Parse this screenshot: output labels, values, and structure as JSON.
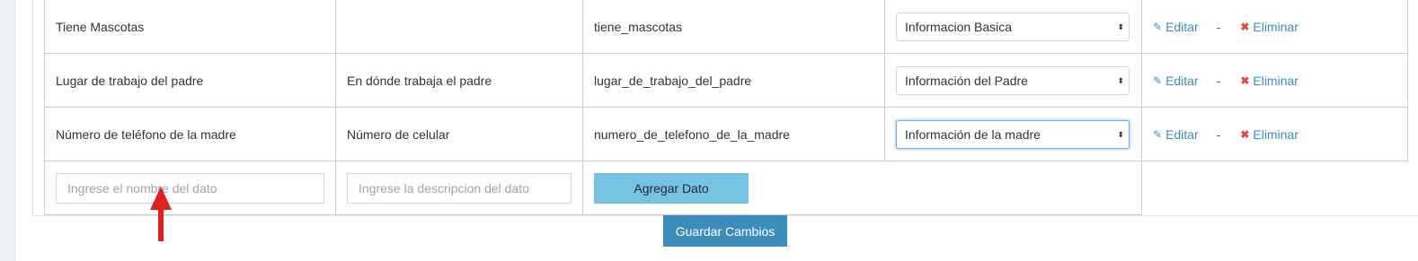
{
  "rows": [
    {
      "name": "Tiene Mascotas",
      "description": "",
      "key": "tiene_mascotas",
      "category": "Informacion Basica",
      "edit_label": "Editar",
      "separator": "-",
      "delete_label": "Eliminar"
    },
    {
      "name": "Lugar de trabajo del padre",
      "description": "En dónde trabaja el padre",
      "key": "lugar_de_trabajo_del_padre",
      "category": "Información del Padre",
      "edit_label": "Editar",
      "separator": "-",
      "delete_label": "Eliminar"
    },
    {
      "name": "Número de teléfono de la madre",
      "description": "Número de celular",
      "key": "numero_de_telefono_de_la_madre",
      "category": "Información de la madre",
      "edit_label": "Editar",
      "separator": "-",
      "delete_label": "Eliminar"
    }
  ],
  "new_field": {
    "name_placeholder": "Ingrese el nombre del dato",
    "description_placeholder": "Ingrese la descripcion del dato",
    "add_button": "Agregar Dato"
  },
  "save_button": "Guardar Cambios",
  "colors": {
    "primary": "#3c8dbc",
    "add_button": "#76c3e1",
    "delete_icon": "#dd4b39",
    "annotation_arrow": "#e02020"
  },
  "icons": {
    "edit": "pencil-icon",
    "delete": "x-icon",
    "select": "select-arrows-icon"
  }
}
